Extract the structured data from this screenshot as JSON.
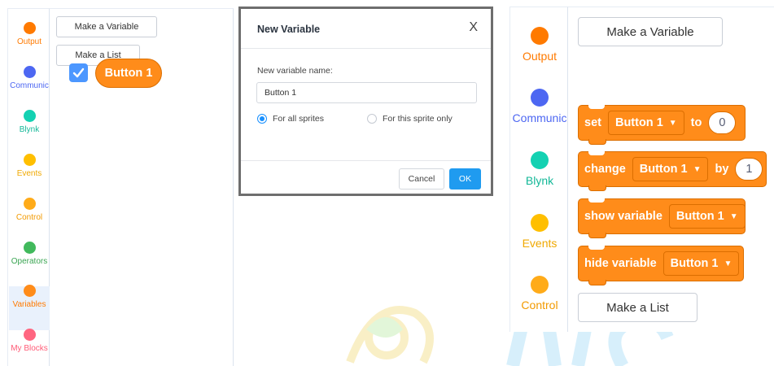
{
  "categories": [
    {
      "label": "Output",
      "color": "#ff7a00",
      "text_color": "#ff7a00"
    },
    {
      "label": "Communic",
      "color": "#4d67f2",
      "text_color": "#4d67f2"
    },
    {
      "label": "Blynk",
      "color": "#14d1b2",
      "text_color": "#14b898"
    },
    {
      "label": "Events",
      "color": "#ffbf00",
      "text_color": "#f0a800"
    },
    {
      "label": "Control",
      "color": "#ffab19",
      "text_color": "#f29a00"
    },
    {
      "label": "Operators",
      "color": "#41b95c",
      "text_color": "#3aa552"
    },
    {
      "label": "Variables",
      "color": "#ff8c1a",
      "text_color": "#ff7a00"
    },
    {
      "label": "My Blocks",
      "color": "#ff6680",
      "text_color": "#ff5c77"
    }
  ],
  "palette": {
    "make_variable": "Make a Variable",
    "make_list": "Make a List"
  },
  "dialog": {
    "title": "New Variable",
    "close": "X",
    "field_label": "New variable name:",
    "field_value": "Button 1",
    "option_all": "For all sprites",
    "option_this": "For this sprite only",
    "cancel": "Cancel",
    "ok": "OK"
  },
  "variable": {
    "name": "Button 1",
    "checked": true
  },
  "blocks": {
    "set": {
      "label": "set",
      "dropdown": "Button 1",
      "connector": "to",
      "value": "0"
    },
    "change": {
      "label": "change",
      "dropdown": "Button 1",
      "connector": "by",
      "value": "1"
    },
    "show": {
      "label": "show variable",
      "dropdown": "Button 1"
    },
    "hide": {
      "label": "hide variable",
      "dropdown": "Button 1"
    }
  },
  "colors": {
    "variable_block": "#ff8c1a",
    "accent_blue": "#1f9bf0"
  }
}
